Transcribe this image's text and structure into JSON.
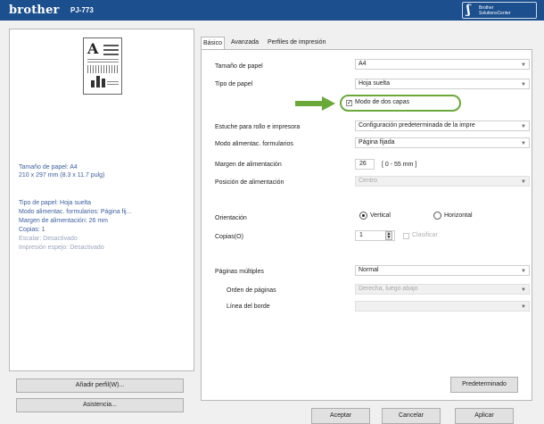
{
  "header": {
    "brand": "brother",
    "model": "PJ-773",
    "logo_line1": "Brother",
    "logo_line2": "SolutionsCenter"
  },
  "summary": {
    "size_line1": "Tamaño de papel: A4",
    "size_line2": "210 x 297 mm (8.3 x 11.7 pulg)",
    "type": "Tipo de papel: Hoja suelta",
    "feed_mode": "Modo alimentac. formularios: Página fij...",
    "feed_margin": "Margen de alimentación: 26 mm",
    "copies": "Copias: 1",
    "scale": "Escalar: Desactivado",
    "mirror": "Impresión espejo: Desactivado"
  },
  "left_buttons": {
    "add_profile": "Añadir perfil(W)...",
    "support": "Asistencia..."
  },
  "tabs": [
    "Básico",
    "Avanzada",
    "Perfiles de impresión"
  ],
  "form": {
    "paper_size_label": "Tamaño de papel",
    "paper_size_value": "A4",
    "paper_type_label": "Tipo de papel",
    "paper_type_value": "Hoja suelta",
    "two_layer_label": "Modo de dos capas",
    "two_layer_checked": true,
    "case_label": "Estuche para rollo e impresora",
    "case_value": "Configuración predeterminada de la impre",
    "feed_mode_label": "Modo alimentac. formularios",
    "feed_mode_value": "Página fijada",
    "feed_margin_label": "Margen de alimentación",
    "feed_margin_value": "26",
    "feed_margin_range": "[ 0 - 55 mm ]",
    "feed_position_label": "Posición de alimentación",
    "feed_position_value": "Centro",
    "orientation_label": "Orientación",
    "orientation_vertical": "Vertical",
    "orientation_horizontal": "Horizontal",
    "orientation_selected": "Vertical",
    "copies_label": "Copias(O)",
    "copies_value": "1",
    "collate_label": "Clasificar",
    "multiple_pages_label": "Páginas múltiples",
    "multiple_pages_value": "Normal",
    "page_order_label": "Orden de páginas",
    "page_order_value": "Derecha, luego abajo",
    "border_line_label": "Línea del borde",
    "border_line_value": ""
  },
  "buttons": {
    "default": "Predeterminado",
    "accept": "Aceptar",
    "cancel": "Cancelar",
    "apply": "Aplicar"
  },
  "colors": {
    "banner": "#1c4f8e",
    "highlight": "#6aa83a",
    "summary_text": "#3d5e9e"
  },
  "icons": [
    "printer-document-preview-icon",
    "green-arrow-icon",
    "dropdown-arrow-icon",
    "spinner-icon"
  ]
}
